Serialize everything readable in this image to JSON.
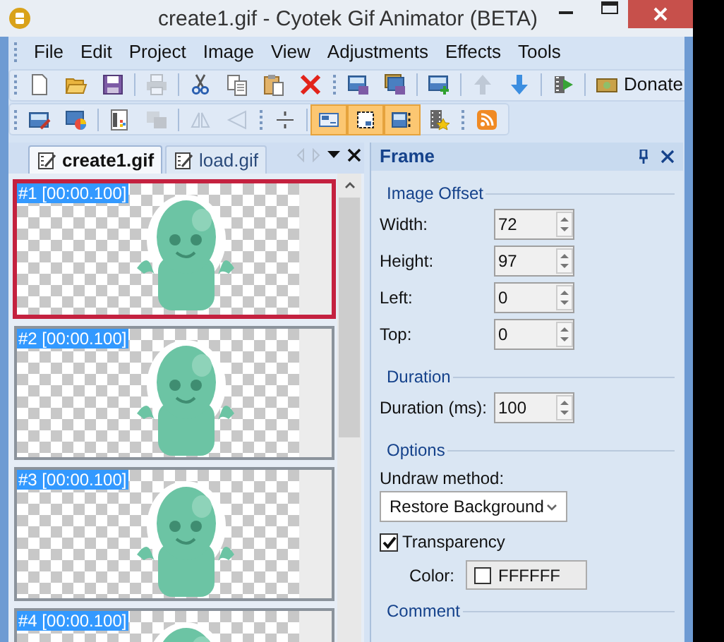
{
  "window": {
    "title": "create1.gif - Cyotek Gif Animator (BETA)"
  },
  "menu": [
    "File",
    "Edit",
    "Project",
    "Image",
    "View",
    "Adjustments",
    "Effects",
    "Tools"
  ],
  "toolbar_1": [
    {
      "kind": "grip"
    },
    {
      "kind": "button",
      "disabled": false
    },
    {
      "kind": "button",
      "disabled": false
    },
    {
      "kind": "button",
      "disabled": false
    },
    {
      "kind": "separator"
    },
    {
      "kind": "button",
      "disabled": true
    },
    {
      "kind": "separator"
    },
    {
      "kind": "button",
      "disabled": false
    },
    {
      "kind": "button",
      "disabled": false
    },
    {
      "kind": "button",
      "disabled": false
    },
    {
      "kind": "button",
      "disabled": false
    },
    {
      "kind": "grip"
    },
    {
      "kind": "button",
      "disabled": false
    },
    {
      "kind": "button",
      "disabled": false
    },
    {
      "kind": "separator"
    },
    {
      "kind": "button",
      "disabled": false
    },
    {
      "kind": "separator"
    },
    {
      "kind": "button",
      "disabled": true
    },
    {
      "kind": "button",
      "disabled": false
    },
    {
      "kind": "separator"
    },
    {
      "kind": "button",
      "disabled": false
    },
    {
      "kind": "separator"
    },
    {
      "kind": "text_button",
      "label": "Donate",
      "disabled": false
    }
  ],
  "toolbar_2": [
    {
      "kind": "grip"
    },
    {
      "kind": "button",
      "disabled": false,
      "selected": false
    },
    {
      "kind": "button",
      "disabled": false,
      "selected": false
    },
    {
      "kind": "separator"
    },
    {
      "kind": "button",
      "disabled": false,
      "selected": false
    },
    {
      "kind": "button",
      "disabled": true,
      "selected": false
    },
    {
      "kind": "separator"
    },
    {
      "kind": "button",
      "disabled": true,
      "selected": false
    },
    {
      "kind": "button",
      "disabled": true,
      "selected": false
    },
    {
      "kind": "grip"
    },
    {
      "kind": "button",
      "disabled": false,
      "selected": false
    },
    {
      "kind": "separator"
    },
    {
      "kind": "button",
      "disabled": false,
      "selected": true
    },
    {
      "kind": "button",
      "disabled": false,
      "selected": true
    },
    {
      "kind": "button",
      "disabled": false,
      "selected": true
    },
    {
      "kind": "button",
      "disabled": false,
      "selected": false
    },
    {
      "kind": "grip"
    },
    {
      "kind": "button",
      "disabled": false,
      "selected": false
    }
  ],
  "document_tabs": [
    {
      "label": "create1.gif",
      "selected": true
    },
    {
      "label": "load.gif",
      "selected": false
    }
  ],
  "frames": [
    {
      "label": "#1 [00:00.100]",
      "selected": true
    },
    {
      "label": "#2 [00:00.100]",
      "selected": false
    },
    {
      "label": "#3 [00:00.100]",
      "selected": false
    },
    {
      "label": "#4 [00:00.100]",
      "selected": false
    }
  ],
  "frame_panel": {
    "title": "Frame",
    "sections": [
      {
        "kind": "spinners",
        "title": "Image Offset",
        "fields": [
          {
            "label": "Width:",
            "value": "72"
          },
          {
            "label": "Height:",
            "value": "97"
          },
          {
            "label": "Left:",
            "value": "0"
          },
          {
            "label": "Top:",
            "value": "0"
          }
        ]
      },
      {
        "kind": "spinners",
        "title": "Duration",
        "fields": [
          {
            "label": "Duration (ms):",
            "value": "100"
          }
        ]
      },
      {
        "kind": "options",
        "title": "Options",
        "undraw_label": "Undraw method:",
        "undraw_value": "Restore Background",
        "transparency": {
          "label": "Transparency",
          "checked": true
        },
        "color": {
          "label": "Color:",
          "value": "FFFFFF"
        }
      },
      {
        "kind": "text",
        "title": "Comment"
      }
    ]
  }
}
